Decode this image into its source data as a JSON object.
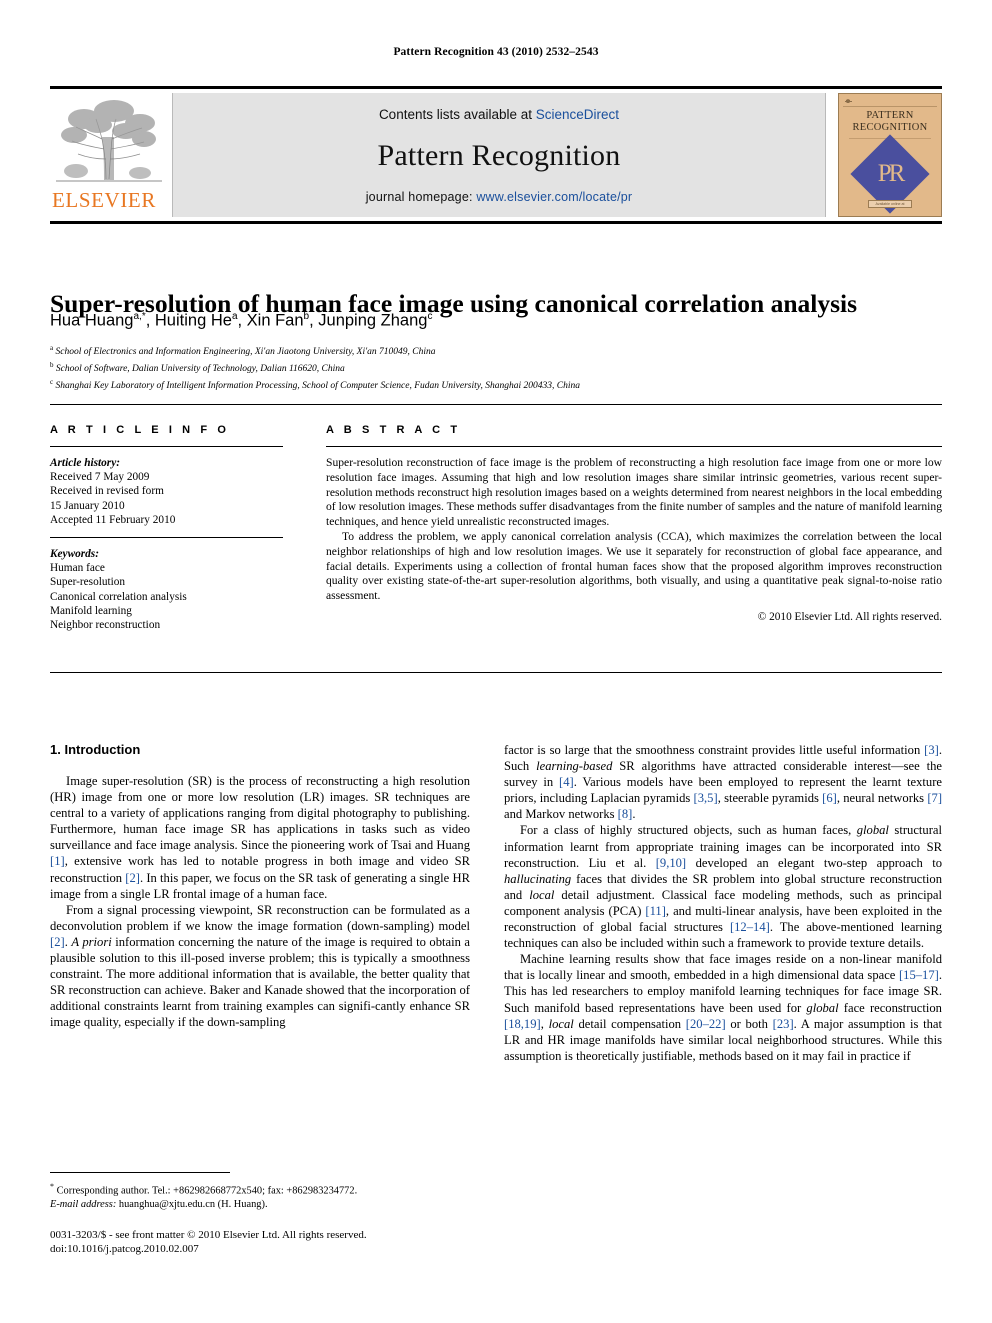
{
  "running_head": "Pattern Recognition 43 (2010) 2532–2543",
  "masthead": {
    "contents_prefix": "Contents lists available at ",
    "sciencedirect": "ScienceDirect",
    "journal_name": "Pattern Recognition",
    "homepage_label": "journal homepage: ",
    "homepage_url": "www.elsevier.com/locate/pr",
    "publisher_wordmark": "ELSEVIER",
    "cover": {
      "title_line1": "PATTERN",
      "title_line2": "RECOGNITION",
      "monogram": "PR",
      "footer_badge": "Available online at"
    },
    "colors": {
      "elsevier_orange": "#E87722",
      "link_blue": "#1a4f9c",
      "masthead_gray": "#e3e3e3",
      "cover_tan": "#e2b98a",
      "cover_blue": "#4a4f9e"
    }
  },
  "article": {
    "title": "Super-resolution of human face image using canonical correlation analysis",
    "authors_html": "Hua Huang<sup>a,*</sup>, Huiting He<sup>a</sup>, Xin Fan<sup>b</sup>, Junping Zhang<sup>c</sup>",
    "affiliations": [
      {
        "marker": "a",
        "text": "School of Electronics and Information Engineering, Xi'an Jiaotong University, Xi'an 710049, China"
      },
      {
        "marker": "b",
        "text": "School of Software, Dalian University of Technology, Dalian 116620, China"
      },
      {
        "marker": "c",
        "text": "Shanghai Key Laboratory of Intelligent Information Processing, School of Computer Science, Fudan University, Shanghai 200433, China"
      }
    ]
  },
  "article_info": {
    "heading": "A R T I C L E   I N F O",
    "history_label": "Article history:",
    "history": [
      "Received 7 May 2009",
      "Received in revised form",
      "15 January 2010",
      "Accepted 11 February 2010"
    ],
    "keywords_label": "Keywords:",
    "keywords": [
      "Human face",
      "Super-resolution",
      "Canonical correlation analysis",
      "Manifold learning",
      "Neighbor reconstruction"
    ]
  },
  "abstract": {
    "heading": "A B S T R A C T",
    "paragraph1": "Super-resolution reconstruction of face image is the problem of reconstructing a high resolution face image from one or more low resolution face images. Assuming that high and low resolution images share similar intrinsic geometries, various recent super-resolution methods reconstruct high resolution images based on a weights determined from nearest neighbors in the local embedding of low resolution images. These methods suffer disadvantages from the finite number of samples and the nature of manifold learning techniques, and hence yield unrealistic reconstructed images.",
    "paragraph2": "To address the problem, we apply canonical correlation analysis (CCA), which maximizes the correlation between the local neighbor relationships of high and low resolution images. We use it separately for reconstruction of global face appearance, and facial details. Experiments using a collection of frontal human faces show that the proposed algorithm improves reconstruction quality over existing state-of-the-art super-resolution algorithms, both visually, and using a quantitative peak signal-to-noise ratio assessment.",
    "copyright": "© 2010 Elsevier Ltd. All rights reserved."
  },
  "introduction": {
    "section_title": "1. Introduction",
    "left_paragraphs": [
      "Image super-resolution (SR) is the process of reconstructing a high resolution (HR) image from one or more low resolution (LR) images. SR techniques are central to a variety of applications ranging from digital photography to publishing. Furthermore, human face image SR has applications in tasks such as video surveillance and face image analysis. Since the pioneering work of Tsai and Huang [1], extensive work has led to notable progress in both image and video SR reconstruction [2]. In this paper, we focus on the SR task of generating a single HR image from a single LR frontal image of a human face.",
      "From a signal processing viewpoint, SR reconstruction can be formulated as a deconvolution problem if we know the image formation (down-sampling) model [2]. A priori information concerning the nature of the image is required to obtain a plausible solution to this ill-posed inverse problem; this is typically a smoothness constraint. The more additional information that is available, the better quality that SR reconstruction can achieve. Baker and Kanade showed that the incorporation of additional constraints learnt from training examples can signifi-cantly enhance SR image quality, especially if the down-sampling"
    ],
    "right_paragraphs": [
      "factor is so large that the smoothness constraint provides little useful information [3]. Such learning-based SR algorithms have attracted considerable interest—see the survey in [4]. Various models have been employed to represent the learnt texture priors, including Laplacian pyramids [3,5], steerable pyramids [6], neural networks [7] and Markov networks [8].",
      "For a class of highly structured objects, such as human faces, global structural information learnt from appropriate training images can be incorporated into SR reconstruction. Liu et al. [9,10] developed an elegant two-step approach to hallucinating faces that divides the SR problem into global structure reconstruction and local detail adjustment. Classical face modeling methods, such as principal component analysis (PCA) [11], and multi-linear analysis, have been exploited in the reconstruction of global facial structures [12–14]. The above-mentioned learning techniques can also be included within such a framework to provide texture details.",
      "Machine learning results show that face images reside on a non-linear manifold that is locally linear and smooth, embedded in a high dimensional data space [15–17]. This has led researchers to employ manifold learning techniques for face image SR. Such manifold based representations have been used for global face reconstruction [18,19], local detail compensation [20–22] or both [23]. A major assumption is that LR and HR image manifolds have similar local neighborhood structures. While this assumption is theoretically justifiable, methods based on it may fail in practice if"
    ]
  },
  "footnotes": {
    "corresponding": "Corresponding author. Tel.: +862982668772x540; fax: +862983234772.",
    "email_label": "E-mail address:",
    "email": "huanghua@xjtu.edu.cn (H. Huang).",
    "issn_line": "0031-3203/$ - see front matter © 2010 Elsevier Ltd. All rights reserved.",
    "doi_line": "doi:10.1016/j.patcog.2010.02.007"
  }
}
